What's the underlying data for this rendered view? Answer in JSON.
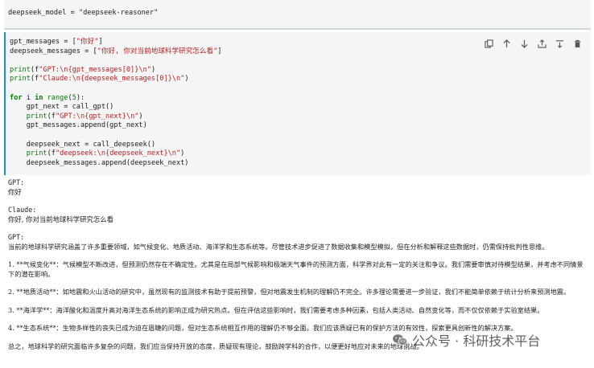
{
  "cell_top": {
    "line1": "deepseek_model = \"deepseek-reasoner\""
  },
  "toolbar": {
    "icons": [
      "copy-icon",
      "move-up-icon",
      "move-down-icon",
      "insert-above-icon",
      "insert-below-icon",
      "delete-icon"
    ]
  },
  "code_lines": [
    "gpt_messages = [\"你好\"]",
    "deepseek_messages = [\"你好, 你对当前地球科学研究怎么看\"]",
    "",
    "print(f\"GPT:\\n{gpt_messages[0]}\\n\")",
    "print(f\"Claude:\\n{deepseek_messages[0]}\\n\")",
    "",
    "for i in range(5):",
    "    gpt_next = call_gpt()",
    "    print(f\"GPT:\\n{gpt_next}\\n\")",
    "    gpt_messages.append(gpt_next)",
    "",
    "    deepseek_next = call_deepseek()",
    "    print(f\"deepseek:\\n{deepseek_next}\\n\")",
    "    deepseek_messages.append(deepseek_next)"
  ],
  "output": {
    "gpt_label_1": "GPT:",
    "gpt_text_1": "你好",
    "claude_label": "Claude:",
    "claude_text": "你好, 你对当前地球科学研究怎么看",
    "gpt_label_2": "GPT:",
    "intro": "当前的地球科学研究涵盖了许多重要领域，如气候变化、地质活动、海洋学和生态系统等。尽管技术进步促进了数据收集和模型模拟，但在分析和解释这些数据时，仍需保持批判性思维。",
    "items": [
      "1. **气候变化**：气候模型不断改进，但预测仍然存在不确定性。尤其是在局部气候影响和极端天气事件的预测方面，科学界对此有一定的关注和争议。我们需要审慎对待模型结果，并考虑不同情景下的潜在影响。",
      "2. **地质活动**：如地震和火山活动的研究中，虽然现有的监测技术有助于提前预警，但对地震发生机制的理解仍不完全。许多理论需要进一步验证，我们不能简单依赖于统计分析来预测地震。",
      "3. **海洋学**：海洋酸化和温度升高对海洋生态系统的影响正成为研究热点。但在评估这些影响时，我们需要考虑多种因素，包括人类活动、自然变化等，而不仅仅依赖于实验室结果。",
      "4. **生态系统**：生物多样性的丧失已成为迫在眉睫的问题，但对生态系统相互作用的理解仍不够全面。我们应该质疑已有的保护方法的有效性，探索更具创新性的解决方案。"
    ],
    "summary": "总之，地球科学的研究面临许多复杂的问题，我们应当保持开放的态度，质疑现有理论，鼓励跨学科的合作，以便更好地应对未来的地球挑战。"
  },
  "watermark": {
    "text": "公众号 · 科研技术平台",
    "icon": "wechat-icon"
  }
}
